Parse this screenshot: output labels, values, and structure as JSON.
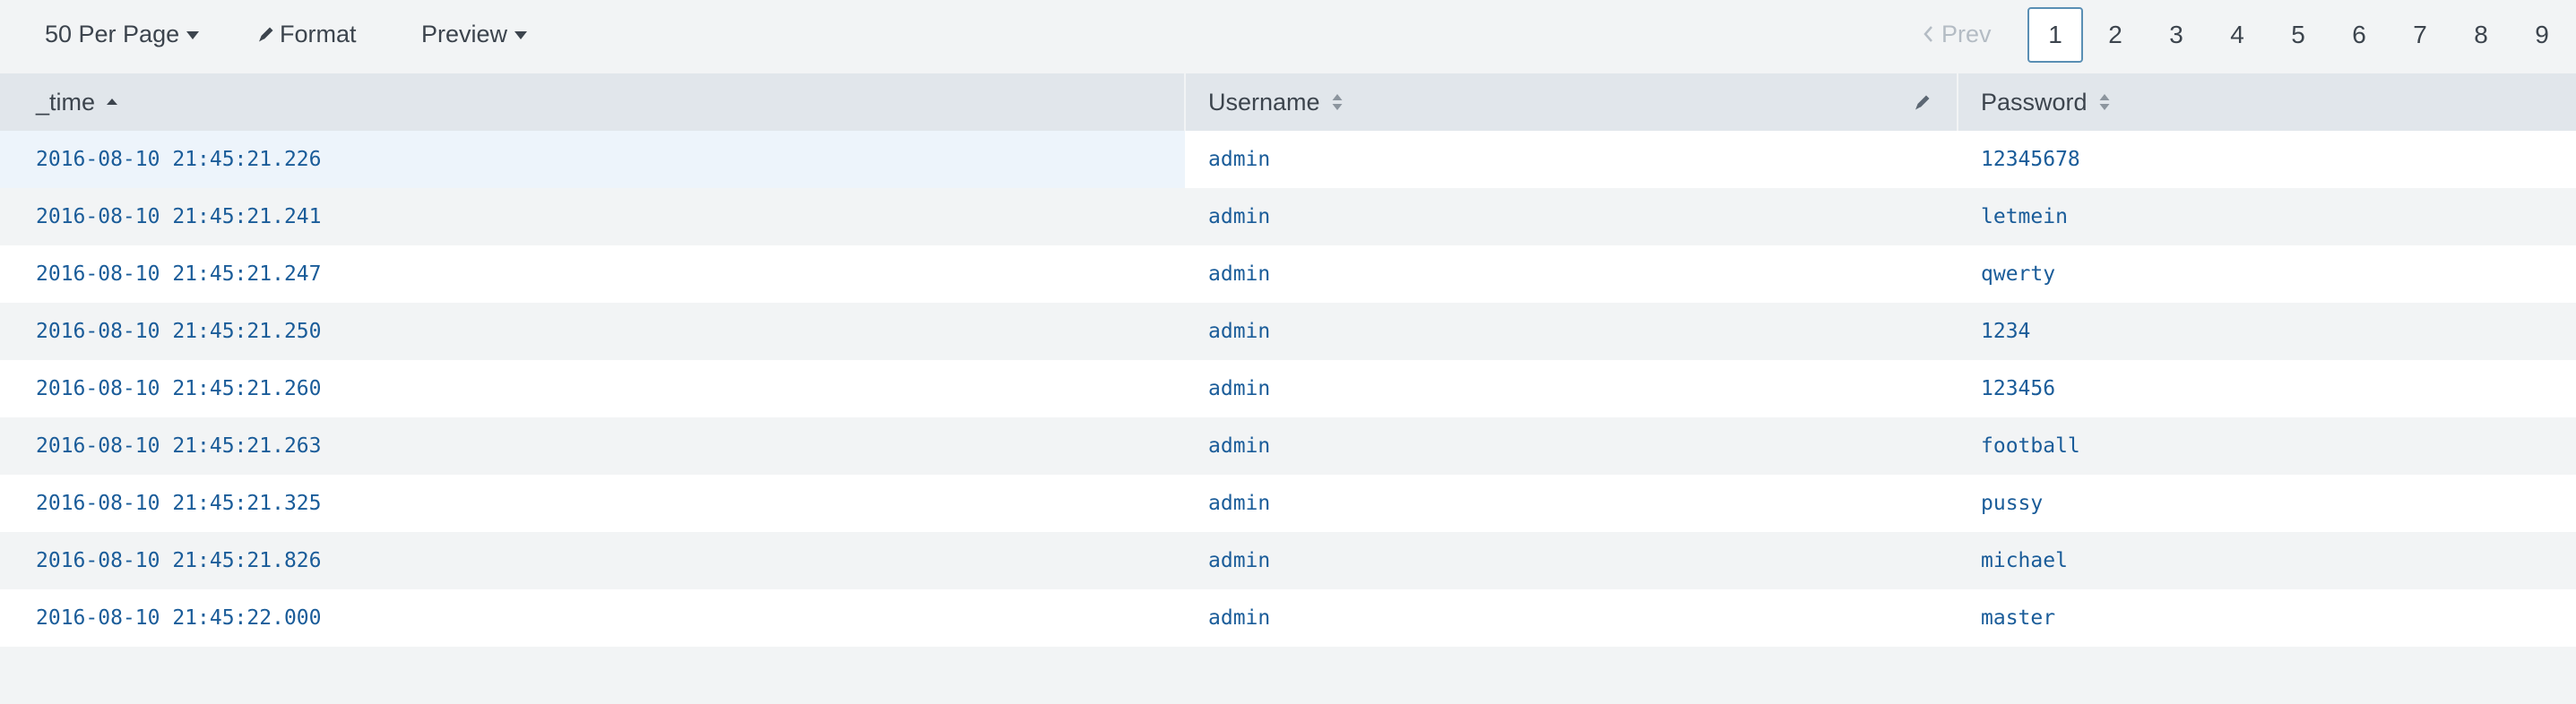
{
  "toolbar": {
    "per_page_label": "50 Per Page",
    "format_label": "Format",
    "preview_label": "Preview",
    "icons": {
      "format": "pencil-icon",
      "dropdown": "caret-down-icon"
    }
  },
  "pagination": {
    "prev_label": "Prev",
    "current_page": "1",
    "pages": [
      "1",
      "2",
      "3",
      "4",
      "5",
      "6",
      "7",
      "8",
      "9"
    ]
  },
  "table": {
    "columns": [
      {
        "key": "time",
        "label": "_time",
        "sort": "ascending"
      },
      {
        "key": "username",
        "label": "Username",
        "sort": "none"
      },
      {
        "key": "password",
        "label": "Password",
        "sort": "none"
      }
    ],
    "rows": [
      {
        "time": "2016-08-10 21:45:21.226",
        "username": "admin",
        "password": "12345678"
      },
      {
        "time": "2016-08-10 21:45:21.241",
        "username": "admin",
        "password": "letmein"
      },
      {
        "time": "2016-08-10 21:45:21.247",
        "username": "admin",
        "password": "qwerty"
      },
      {
        "time": "2016-08-10 21:45:21.250",
        "username": "admin",
        "password": "1234"
      },
      {
        "time": "2016-08-10 21:45:21.260",
        "username": "admin",
        "password": "123456"
      },
      {
        "time": "2016-08-10 21:45:21.263",
        "username": "admin",
        "password": "football"
      },
      {
        "time": "2016-08-10 21:45:21.325",
        "username": "admin",
        "password": "pussy"
      },
      {
        "time": "2016-08-10 21:45:21.826",
        "username": "admin",
        "password": "michael"
      },
      {
        "time": "2016-08-10 21:45:22.000",
        "username": "admin",
        "password": "master"
      }
    ]
  },
  "colors": {
    "link_text": "#1a5c99",
    "header_bg": "#e1e6eb",
    "row_alt_bg": "#f2f4f5",
    "highlight_bg": "#edf4fb",
    "active_page_border": "#5a8fb4",
    "disabled_text": "#b4bcc4"
  }
}
